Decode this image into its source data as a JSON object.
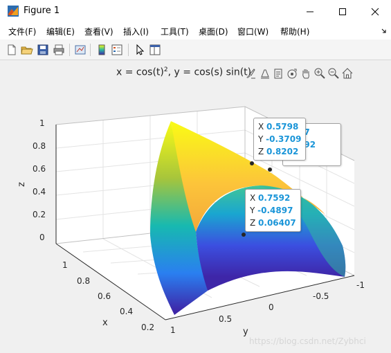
{
  "window": {
    "title": "Figure 1",
    "minimize_label": "—",
    "maximize_label": "☐",
    "close_label": "✕"
  },
  "menu": [
    "文件(F)",
    "编辑(E)",
    "查看(V)",
    "插入(I)",
    "工具(T)",
    "桌面(D)",
    "窗口(W)",
    "帮助(H)"
  ],
  "toolbar_icons": [
    "new-file-icon",
    "open-folder-icon",
    "save-icon",
    "print-icon",
    "link-plot-icon",
    "colorbar-icon",
    "legend-icon",
    "pointer-icon",
    "property-editor-icon"
  ],
  "plot": {
    "title_main": "x = cos(t)",
    "title_sup": "2",
    "title_rest": ", y = cos(s) sin(t)",
    "z_ticks": [
      "1",
      "0.8",
      "0.6",
      "0.4",
      "0.2",
      "0"
    ],
    "x_ticks": [
      "1",
      "0.8",
      "0.6",
      "0.4",
      "0.2"
    ],
    "y_ticks": [
      "-1",
      "-0.5",
      "0",
      "0.5",
      "1"
    ],
    "zlabel": "z",
    "xlabel": "x",
    "ylabel": "y",
    "colormap": "parula"
  },
  "datatips": {
    "tip1": {
      "x": "0.5798",
      "y": "-0.3709",
      "z": "0.8202"
    },
    "tip2": {
      "x": "0.7592",
      "y": "-0.4897",
      "z": "0.06407"
    },
    "tip_behind": {
      "l1": "87",
      "l2": "392",
      "l3": "1"
    }
  },
  "watermark": "https://blog.csdn.net/Zybhci"
}
